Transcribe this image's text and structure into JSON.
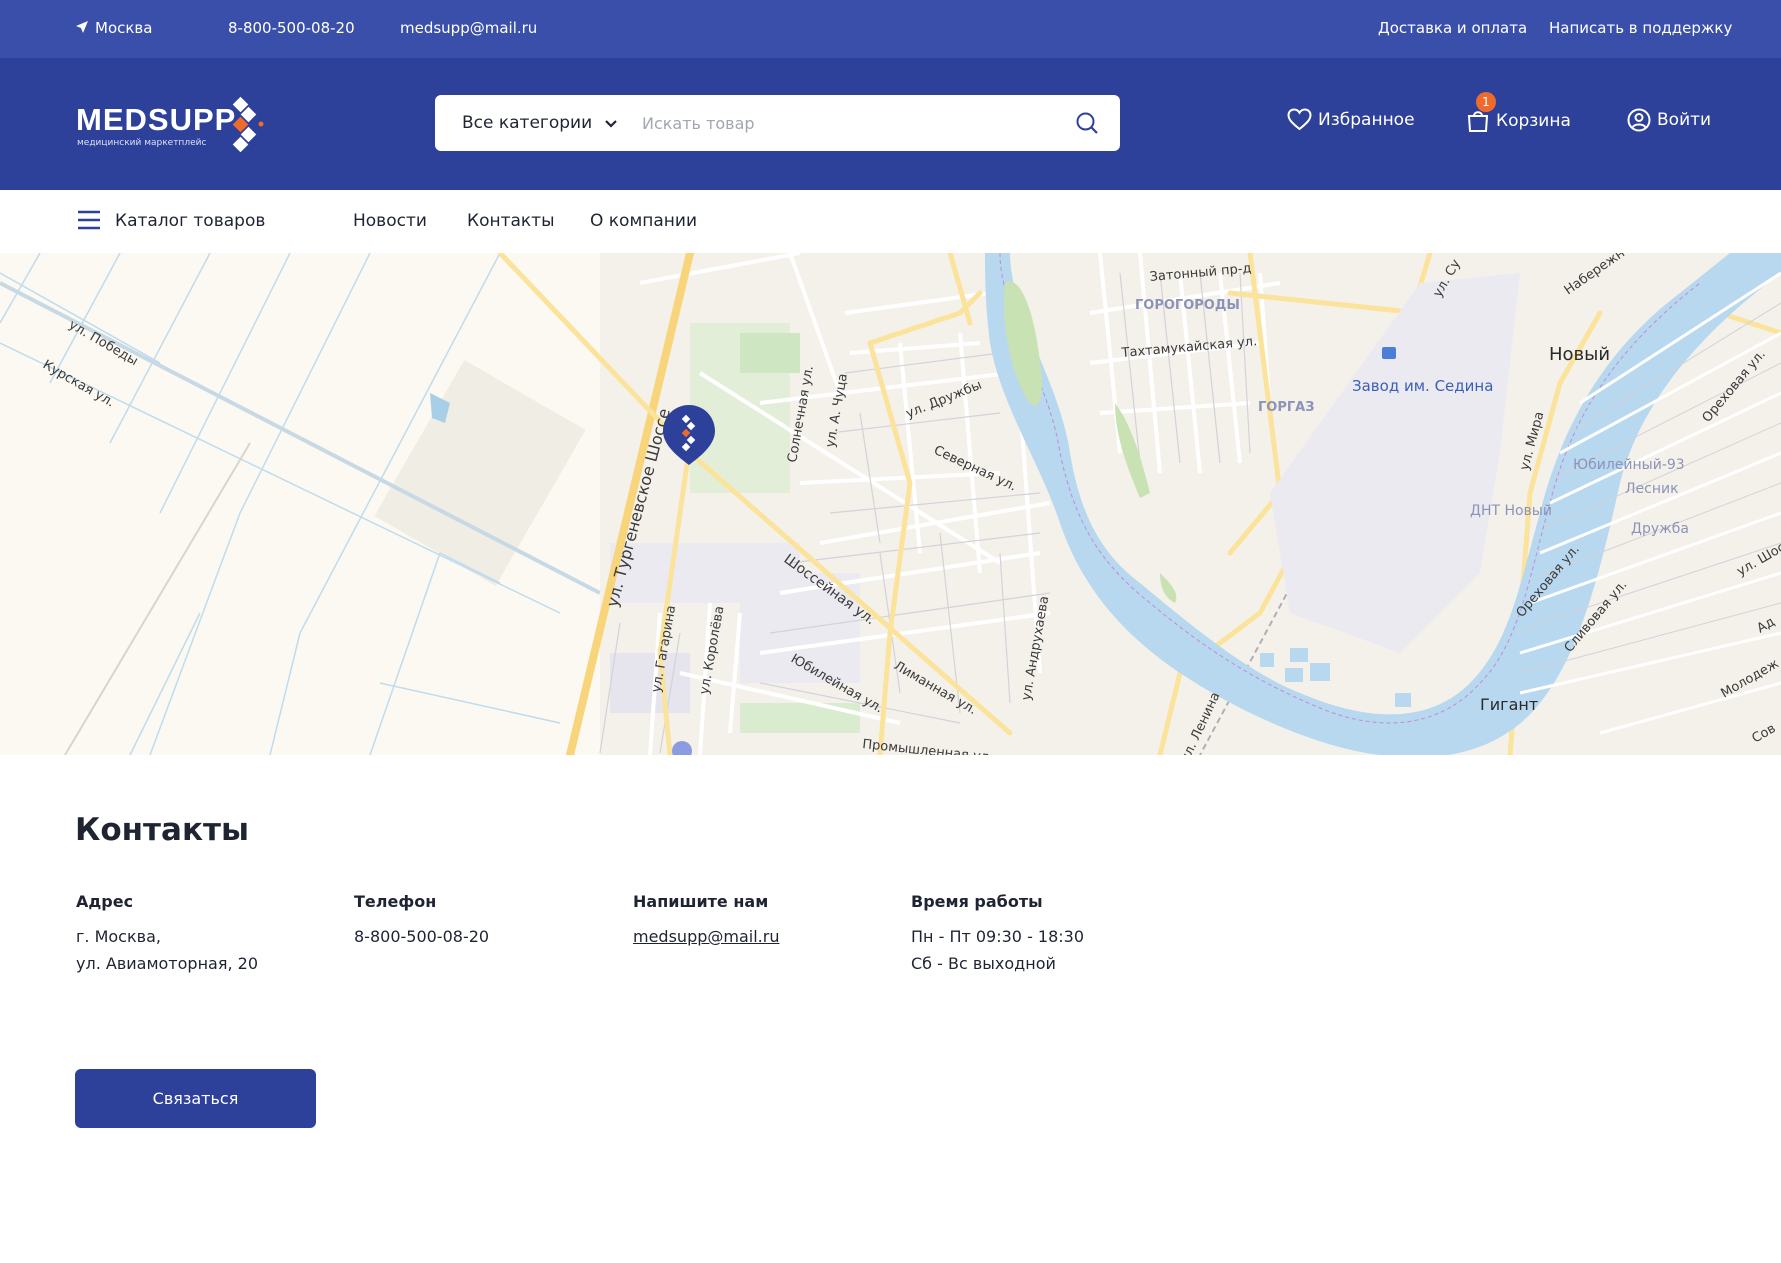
{
  "topbar": {
    "city": "Москва",
    "phone": "8-800-500-08-20",
    "email": "medsupp@mail.ru",
    "delivery": "Доставка и оплата",
    "support": "Написать в поддержку"
  },
  "header": {
    "logo_text": "MEDSUPP",
    "logo_subtitle": "медицинский маркетплейс",
    "search": {
      "category": "Все категории",
      "placeholder": "Искать товар"
    },
    "favorites": "Избранное",
    "cart": "Корзина",
    "cart_count": "1",
    "login": "Войти"
  },
  "nav": {
    "catalog": "Каталог товаров",
    "news": "Новости",
    "contacts": "Контакты",
    "about": "О компании"
  },
  "map": {
    "labels": {
      "pobedy": "ул. Победы",
      "kurskaya": "Курская ул.",
      "turgenevskoe": "ул. Тургеневское Шоссе",
      "gagarina": "ул. Гагарина",
      "koroleva": "ул. Королёва",
      "solnechnaya": "Солнечная ул.",
      "chutsa": "ул. А. Чуца",
      "druzhby": "ул. Дружбы",
      "severnaya": "Северная ул.",
      "shosseynaya": "Шоссейная ул.",
      "yubileynaya": "Юбилейная ул.",
      "limannaya": "Лиманная ул.",
      "andrukhaeva": "ул. Андрухаева",
      "promyshlennaya": "Промышленная ул.",
      "zatonny": "Затонный пр-д",
      "gorogorody": "ГОРОГОРОДЫ",
      "takhtamukayskaya": "Тахтамукайская ул.",
      "gorgaz": "ГОРГАЗ",
      "zavod": "Завод им. Седина",
      "su": "ул. Су",
      "naberezh": "Набережн",
      "noviy": "Новый",
      "orekhovaya_top": "Ореховая ул.",
      "mira": "ул. Мира",
      "yubileyny93": "Юбилейный-93",
      "lesnik": "Лесник",
      "dnt": "ДНТ Новый",
      "druzhba": "Дружба",
      "orekhovaya": "Ореховая ул.",
      "slivovaya": "Сливовая ул.",
      "shosh": "ул. Шос",
      "ad": "Ад",
      "molodezh": "Молодеж",
      "sov": "Сов",
      "gigant": "Гигант",
      "lenina": "ул. Ленина"
    }
  },
  "contacts": {
    "title": "Контакты",
    "address": {
      "label": "Адрес",
      "line1": "г. Москва,",
      "line2": "ул. Авиамоторная, 20"
    },
    "phone": {
      "label": "Телефон",
      "value": "8-800-500-08-20"
    },
    "write": {
      "label": "Напишите нам",
      "value": "medsupp@mail.ru"
    },
    "hours": {
      "label": "Время работы",
      "line1": "Пн - Пт 09:30 - 18:30",
      "line2": "Сб - Вс выходной"
    },
    "button": "Связаться"
  },
  "colors": {
    "topbar": "#3a4faa",
    "header": "#2e419a",
    "accent": "#ef6b2b",
    "button": "#2e419a"
  }
}
